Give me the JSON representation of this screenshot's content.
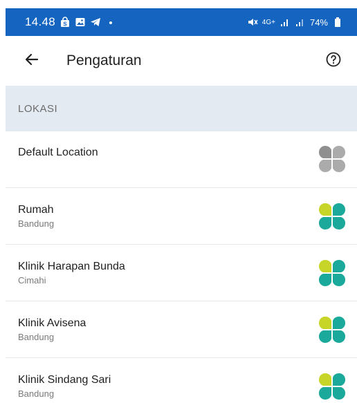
{
  "status_bar": {
    "time": "14.48",
    "network": "4G+",
    "battery": "74%"
  },
  "app_bar": {
    "title": "Pengaturan"
  },
  "section": {
    "label": "LOKASI"
  },
  "locations": [
    {
      "name": "Default Location",
      "city": "",
      "icon": "grey-clover-icon"
    },
    {
      "name": "Rumah",
      "city": "Bandung",
      "icon": "color-clover-icon"
    },
    {
      "name": "Klinik Harapan Bunda",
      "city": "Cimahi",
      "icon": "color-clover-icon"
    },
    {
      "name": "Klinik Avisena",
      "city": "Bandung",
      "icon": "color-clover-icon"
    },
    {
      "name": "Klinik Sindang Sari",
      "city": "Bandung",
      "icon": "color-clover-icon"
    }
  ],
  "colors": {
    "status_bar": "#1565c0",
    "section_header_bg": "#e4eaf1",
    "clover_lime": "#c7d529",
    "clover_teal": "#1aa99a",
    "clover_grey": "#9a9a9a"
  }
}
